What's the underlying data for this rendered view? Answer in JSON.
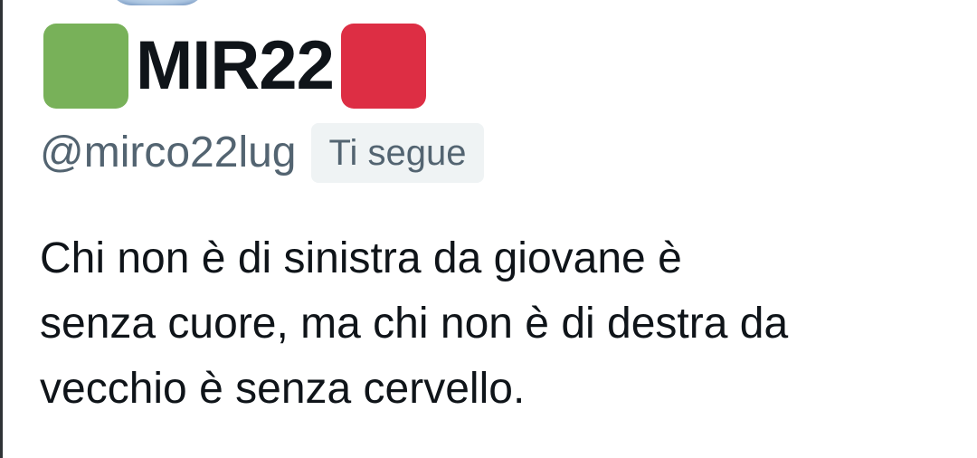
{
  "profile": {
    "display_name": "MIR22",
    "name_emoji_left_color": "#78b159",
    "name_emoji_right_color": "#dd2e44",
    "handle": "@mirco22lug",
    "follows_you_label": "Ti segue"
  },
  "tweet": {
    "text": "Chi non è di sinistra da giovane è\nsenza cuore, ma chi non è di destra da\nvecchio è senza cervello."
  },
  "colors": {
    "text_primary": "#0f1419",
    "text_secondary": "#536471",
    "badge_background": "#eff3f4"
  }
}
